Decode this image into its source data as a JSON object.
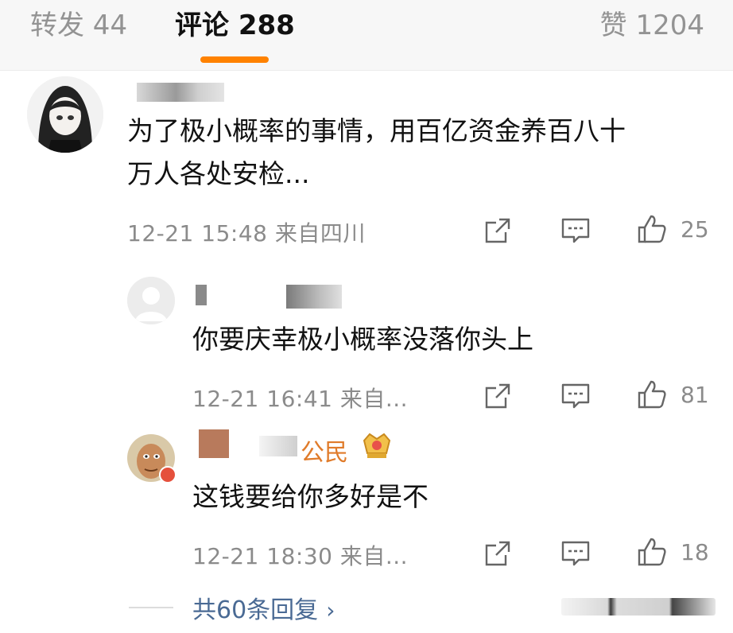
{
  "tabs": {
    "repost": "转发 44",
    "comments": "评论 288",
    "likes": "赞 1204",
    "accent_color": "#ff8200"
  },
  "comments": [
    {
      "name_visible": "",
      "text_line1": "为了极小概率的事情，用百亿资金养百八十",
      "text_line2": "万人各处安检...",
      "time": "12-21 15:48",
      "location": "来自四川",
      "likes": "25"
    },
    {
      "name_visible": "",
      "text": "你要庆幸极小概率没落你头上",
      "time": "12-21 16:41",
      "location": "来自...",
      "likes": "81"
    },
    {
      "name_visible": "公民",
      "text": "这钱要给你多好是不",
      "time": "12-21 18:30",
      "location": "来自...",
      "likes": "18",
      "badge_icon": "crown-medal-icon"
    }
  ],
  "replies": {
    "label": "共60条回复",
    "chevron": "›"
  },
  "icons": [
    "share-icon",
    "comment-icon",
    "thumbs-up-icon",
    "chevron-right-icon"
  ]
}
